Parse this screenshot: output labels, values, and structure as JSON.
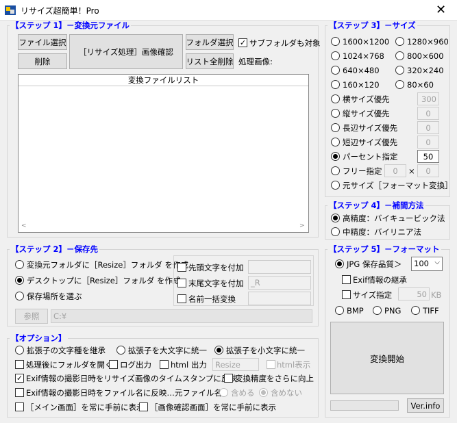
{
  "window": {
    "title": "リサイズ超簡単！Pro",
    "close": "✕",
    "icon": "app-icon"
  },
  "step1": {
    "label": "【ステップ 1】－変換元ファイル",
    "file_select": "ファイル選択",
    "delete": "削除",
    "process_confirm": "［リサイズ処理］画像確認",
    "folder_select": "フォルダ選択",
    "clear_list": "リスト全削除",
    "subfolder": "サブフォルダも対象",
    "processing_image": "処理画像:",
    "list_header": "変換ファイルリスト"
  },
  "step2": {
    "label": "【ステップ 2】－保存先",
    "opt1": "変換元フォルダに［Resize］フォルダ を作成",
    "opt2": "デスクトップに［Resize］フォルダ を作成",
    "opt3": "保存場所を選ぶ",
    "prefix": "先頭文字を付加",
    "suffix": "末尾文字を付加",
    "rename": "名前一括変換",
    "prefix_value": "",
    "suffix_value": "_R",
    "rename_value": "",
    "browse": "参照",
    "path": "C:¥"
  },
  "options": {
    "label": "【オプション】",
    "ext_keep": "拡張子の文字種を継承",
    "ext_upper": "拡張子を大文字に統一",
    "ext_lower": "拡張子を小文字に統一",
    "open_folder": "処理後にフォルダを開く",
    "log_output": "ログ出力",
    "html_output": "html 出力",
    "html_name": "Resize",
    "html_display": "html表示",
    "exif_timestamp": "Exif情報の撮影日時をリサイズ画像のタイムスタンプに反映",
    "improve_precision": "変換精度をさらに向上",
    "exif_filename": "Exif情報の撮影日時をファイル名に反映…元ファイル名 ：",
    "include": "含める",
    "exclude": "含めない",
    "main_front": "［メイン画面］を常に手前に表示",
    "preview_front": "［画像確認画面］を常に手前に表示"
  },
  "step3": {
    "label": "【ステップ 3】－サイズ",
    "sizes": [
      "1600×1200",
      "1280×960",
      "1024×768",
      "800×600",
      "640×480",
      "320×240",
      "160×120",
      "80×60"
    ],
    "width_priority": "横サイズ優先",
    "width_value": "300",
    "height_priority": "縦サイズ優先",
    "height_value": "0",
    "long_priority": "長辺サイズ優先",
    "long_value": "0",
    "short_priority": "短辺サイズ優先",
    "short_value": "0",
    "percent": "パーセント指定",
    "percent_value": "50",
    "free": "フリー指定",
    "free_w": "0",
    "times": "×",
    "free_h": "0",
    "original": "元サイズ［フォーマット変換］"
  },
  "step4": {
    "label": "【ステップ 4】－補間方法",
    "high": "高精度：バイキュービック法",
    "medium": "中精度：バイリニア法"
  },
  "step5": {
    "label": "【ステップ 5】－フォーマット",
    "jpg": "JPG 保存品質＞",
    "quality": "100",
    "exif_keep": "Exif情報の継承",
    "size_spec": "サイズ指定",
    "size_value": "50",
    "kb": "KB",
    "bmp": "BMP",
    "png": "PNG",
    "tiff": "TIFF",
    "start": "変換開始",
    "ver": "Ver.info"
  }
}
